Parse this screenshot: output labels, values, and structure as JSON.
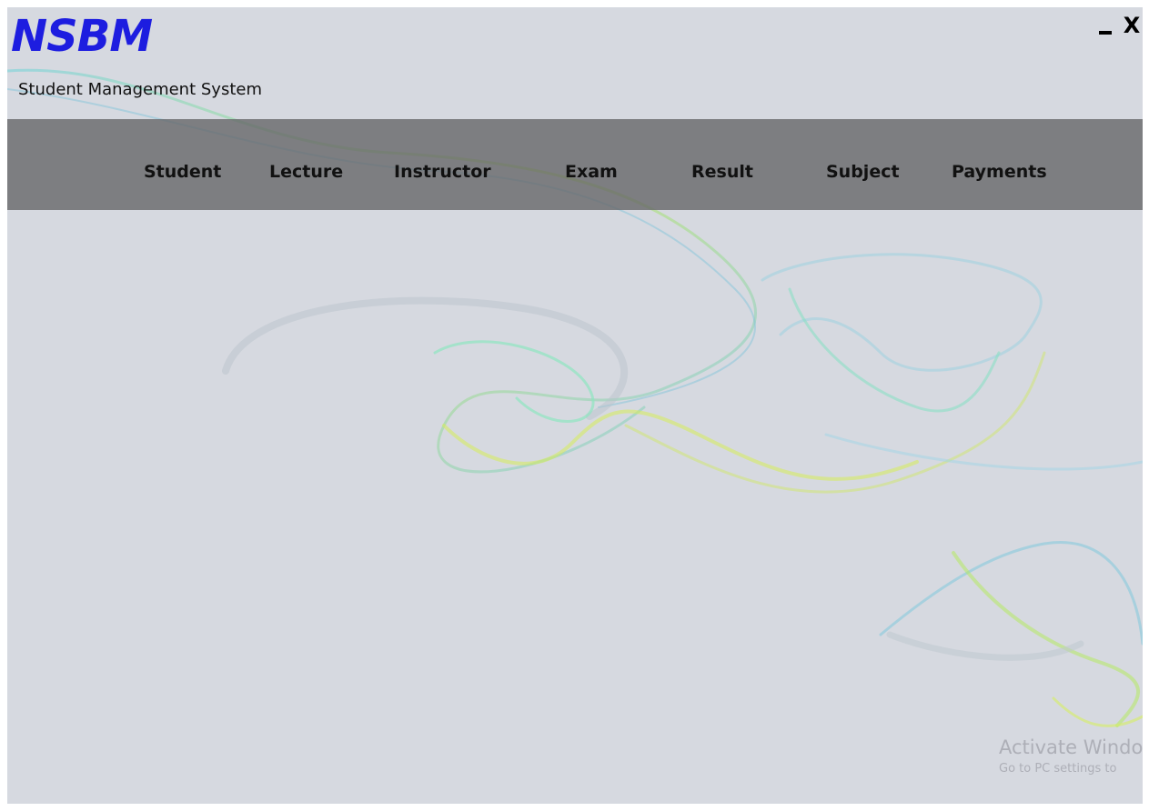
{
  "app": {
    "logo_text": "NSBM",
    "subtitle": "Student Management System"
  },
  "window_controls": {
    "minimize_icon": "minimize-icon",
    "close_label": "X"
  },
  "nav": {
    "items": [
      {
        "label": "Student"
      },
      {
        "label": "Lecture"
      },
      {
        "label": "Instructor"
      },
      {
        "label": "Exam"
      },
      {
        "label": "Result"
      },
      {
        "label": "Subject"
      },
      {
        "label": "Payments"
      }
    ]
  },
  "watermark": {
    "line1": "Activate Windo",
    "line2": "Go to PC settings to"
  },
  "colors": {
    "background": "#d6d9e0",
    "logo": "#1d1de0",
    "nav_bar": "#646466"
  }
}
